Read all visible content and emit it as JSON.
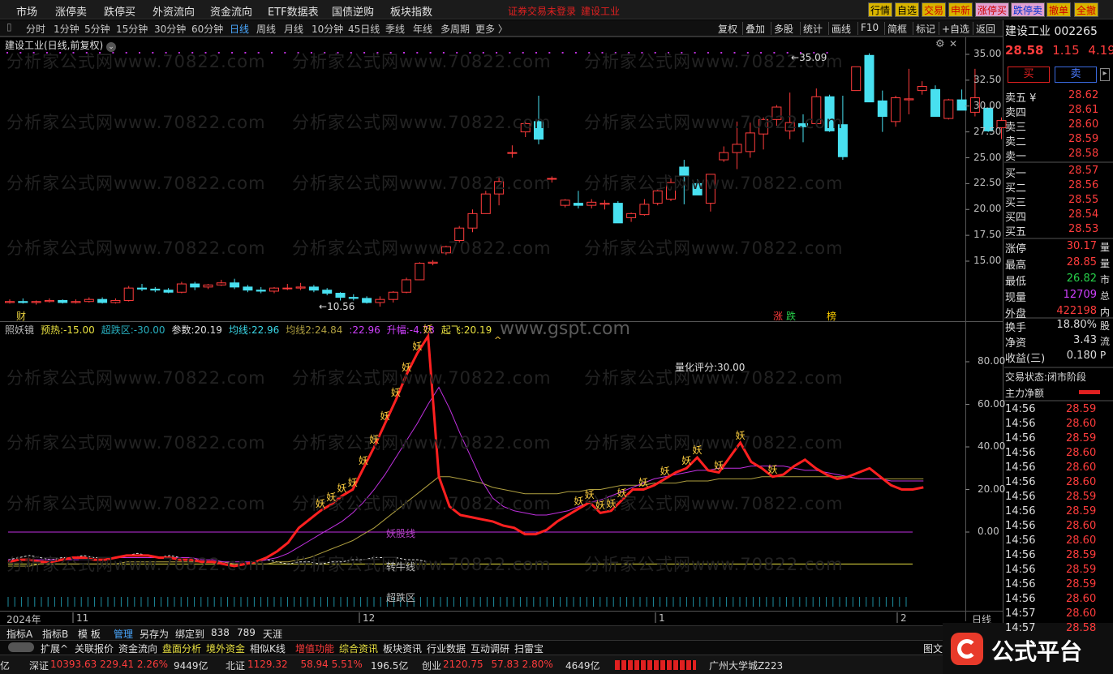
{
  "menu": {
    "items": [
      "市场",
      "涨停卖",
      "跌停买",
      "外资流向",
      "资金流向",
      "ETF数据表",
      "国债逆购",
      "板块指数"
    ],
    "warning": "证券交易未登录",
    "stock_link": "建设工业",
    "right_buttons": [
      {
        "label": "行情",
        "bg": "#d8b400",
        "fg": "#000"
      },
      {
        "label": "自选",
        "bg": "#d8b400",
        "fg": "#000"
      },
      {
        "label": "交易",
        "bg": "#d8b400",
        "fg": "#d00000"
      },
      {
        "label": "申新",
        "bg": "#d8b400",
        "fg": "#d00000"
      },
      {
        "label": "涨停买",
        "bg": "#e0a0d0",
        "fg": "#d00000"
      },
      {
        "label": "跌停卖",
        "bg": "#e0a0d0",
        "fg": "#0030d0"
      },
      {
        "label": "撤单",
        "bg": "#d8b400",
        "fg": "#d00000"
      },
      {
        "label": "全撤",
        "bg": "#d8b400",
        "fg": "#d00000"
      }
    ]
  },
  "periods": [
    "分时",
    "1分钟",
    "5分钟",
    "15分钟",
    "30分钟",
    "60分钟",
    "日线",
    "周线",
    "月线",
    "10分钟",
    "45日线",
    "季线",
    "年线",
    "多周期",
    "更多 〉"
  ],
  "selected_period": "日线",
  "tools": [
    "复权",
    "叠加",
    "多股",
    "统计",
    "画线",
    "F10",
    "简框",
    "标记",
    "+自选",
    "返回"
  ],
  "chart": {
    "title": "建设工业(日线,前复权)",
    "title_icon": "chevron-down-icon",
    "high_label": "35.09",
    "low_label": "10.56",
    "fin_mark": "财",
    "signals": [
      {
        "t": "涨",
        "c": "#ff3c3c"
      },
      {
        "t": "跌",
        "c": "#27d04a"
      },
      {
        "t": "榜",
        "c": "#ffd000"
      }
    ],
    "yticks": [
      "35.00",
      "32.50",
      "30.00",
      "27.50",
      "25.00",
      "22.50",
      "20.00",
      "17.50",
      "15.00"
    ]
  },
  "chart_data": [
    {
      "type": "candlestick",
      "title": "建设工业(日线,前复权)",
      "ylim": [
        10,
        36
      ],
      "ohlc": [
        [
          11.0,
          11.3,
          10.9,
          11.1
        ],
        [
          11.1,
          11.4,
          10.9,
          11.0
        ],
        [
          11.0,
          11.2,
          10.8,
          11.1
        ],
        [
          11.1,
          11.4,
          11.0,
          11.2
        ],
        [
          11.2,
          11.3,
          10.9,
          11.0
        ],
        [
          11.0,
          11.3,
          10.9,
          11.1
        ],
        [
          11.1,
          11.5,
          11.0,
          11.3
        ],
        [
          11.3,
          11.5,
          10.9,
          11.0
        ],
        [
          11.0,
          11.4,
          10.9,
          11.2
        ],
        [
          11.2,
          12.6,
          11.1,
          12.4
        ],
        [
          12.4,
          12.8,
          12.1,
          12.3
        ],
        [
          12.3,
          12.5,
          12.0,
          12.2
        ],
        [
          12.2,
          12.4,
          11.9,
          12.0
        ],
        [
          12.0,
          13.0,
          11.9,
          12.8
        ],
        [
          12.8,
          13.0,
          12.2,
          12.5
        ],
        [
          12.5,
          12.8,
          12.3,
          12.7
        ],
        [
          12.7,
          13.2,
          12.6,
          12.9
        ],
        [
          12.9,
          13.3,
          12.3,
          12.5
        ],
        [
          12.5,
          12.7,
          12.0,
          12.2
        ],
        [
          12.2,
          12.5,
          11.9,
          12.1
        ],
        [
          12.1,
          12.5,
          11.9,
          12.4
        ],
        [
          12.4,
          12.8,
          12.2,
          12.4
        ],
        [
          12.4,
          12.9,
          12.2,
          12.5
        ],
        [
          12.5,
          12.7,
          12.0,
          12.2
        ],
        [
          12.2,
          12.4,
          11.7,
          11.9
        ],
        [
          11.9,
          12.0,
          11.2,
          11.5
        ],
        [
          11.5,
          11.8,
          11.2,
          11.4
        ],
        [
          11.4,
          11.6,
          10.9,
          11.0
        ],
        [
          11.0,
          11.6,
          10.6,
          11.3
        ],
        [
          11.3,
          12.1,
          11.0,
          12.0
        ],
        [
          12.0,
          13.4,
          11.9,
          13.2
        ],
        [
          13.2,
          14.9,
          13.2,
          14.8
        ],
        [
          14.8,
          15.1,
          14.6,
          14.9
        ],
        [
          15.8,
          16.5,
          15.6,
          16.4
        ],
        [
          17.0,
          18.4,
          16.8,
          18.2
        ],
        [
          18.2,
          20.0,
          17.8,
          19.6
        ],
        [
          19.6,
          21.8,
          19.6,
          21.5
        ],
        [
          21.5,
          23.2,
          20.4,
          22.7
        ],
        [
          25.5,
          26.2,
          25.0,
          25.5
        ],
        [
          27.5,
          28.5,
          27.0,
          28.3
        ],
        [
          28.5,
          31.0,
          26.3,
          26.8
        ],
        [
          23.0,
          23.2,
          22.6,
          23.0
        ],
        [
          20.4,
          21.0,
          20.2,
          20.9
        ],
        [
          20.6,
          21.8,
          20.1,
          20.4
        ],
        [
          20.4,
          21.0,
          20.1,
          20.7
        ],
        [
          20.5,
          20.9,
          20.0,
          20.6
        ],
        [
          20.6,
          20.8,
          18.7,
          18.7
        ],
        [
          19.2,
          19.7,
          18.8,
          19.6
        ],
        [
          19.5,
          21.0,
          19.4,
          20.5
        ],
        [
          20.6,
          22.0,
          20.4,
          21.8
        ],
        [
          21.0,
          23.0,
          20.8,
          22.6
        ],
        [
          24.1,
          24.8,
          20.5,
          23.2
        ],
        [
          22.5,
          22.9,
          21.4,
          21.4
        ],
        [
          20.6,
          21.7,
          19.8,
          23.4
        ],
        [
          24.8,
          26.1,
          24.6,
          25.5
        ],
        [
          25.5,
          28.5,
          23.9,
          26.3
        ],
        [
          25.6,
          28.4,
          25.0,
          27.4
        ],
        [
          27.3,
          28.9,
          25.8,
          28.7
        ],
        [
          28.7,
          30.1,
          28.1,
          29.9
        ],
        [
          27.6,
          31.3,
          26.8,
          28.4
        ],
        [
          28.3,
          29.2,
          26.5,
          28.0
        ],
        [
          28.3,
          31.7,
          28.3,
          30.9
        ],
        [
          30.9,
          31.1,
          27.5,
          27.6
        ],
        [
          28.2,
          31.0,
          24.8,
          25.1
        ],
        [
          31.5,
          33.8,
          31.5,
          33.8
        ],
        [
          34.9,
          35.1,
          30.4,
          30.4
        ],
        [
          30.5,
          31.5,
          27.5,
          29.0
        ],
        [
          28.5,
          31.0,
          28.0,
          30.8
        ],
        [
          30.6,
          33.6,
          29.2,
          30.7
        ],
        [
          31.5,
          32.4,
          31.1,
          31.9
        ],
        [
          31.6,
          32.0,
          29.0,
          29.0
        ],
        [
          28.8,
          30.7,
          28.7,
          30.6
        ],
        [
          30.6,
          31.6,
          29.6,
          29.6
        ],
        [
          29.4,
          33.6,
          29.0,
          30.8
        ],
        [
          29.8,
          29.8,
          27.5,
          27.6
        ],
        [
          27.9,
          28.9,
          26.8,
          28.6
        ]
      ]
    },
    {
      "type": "line",
      "title": "照妖镜",
      "ylim": [
        -40,
        95
      ],
      "yticks": [
        "80.00",
        "60.00",
        "40.00",
        "20.00",
        "0.00"
      ],
      "legend": [
        {
          "name": "照妖镜",
          "c": "#bbbbbb"
        },
        {
          "name": "预热:",
          "v": "-15.00",
          "c": "#e8e040"
        },
        {
          "name": "超跌区:",
          "v": "-30.00",
          "c": "#28b0c0"
        },
        {
          "name": "参数:",
          "v": "20.19",
          "c": "#e0e0e0"
        },
        {
          "name": "均线:",
          "v": "22.96",
          "c": "#3ad8e8"
        },
        {
          "name": "均线2:",
          "v": "24.84",
          "c": "#b0a040"
        },
        {
          "name": "",
          "v": ":22.96",
          "c": "#d040ff"
        },
        {
          "name": "升幅:",
          "v": "-4.73",
          "c": "#d040ff"
        },
        {
          "name": "起飞:",
          "v": "20.19",
          "c": "#e8e040"
        }
      ],
      "annotation": "量化评分:30.00",
      "yao_char": "妖",
      "labels": [
        "妖股线",
        "转牛线",
        "超跌区"
      ],
      "lines": {
        "yaogu": 0,
        "zhuanniu": -15
      },
      "series": [
        {
          "name": "参数",
          "color": "#ff2020",
          "values": [
            -14,
            -13,
            -13,
            -14,
            -14,
            -13,
            -12,
            -12,
            -13,
            -13,
            -12,
            -11,
            -11,
            -11,
            -12,
            -12,
            -13,
            -13,
            -14,
            -14,
            -15,
            -16,
            -15,
            -14,
            -12,
            -9,
            -5,
            2,
            6,
            10,
            13,
            17,
            20,
            30,
            40,
            51,
            62,
            74,
            84,
            92,
            26,
            12,
            8,
            7,
            6,
            5,
            3,
            2,
            -1,
            -1,
            1,
            5,
            8,
            11,
            14,
            9,
            10,
            15,
            20,
            20,
            22,
            25,
            28,
            30,
            35,
            29,
            28,
            35,
            42,
            33,
            30,
            26,
            27,
            31,
            34,
            30,
            27,
            25,
            26,
            28,
            30,
            26,
            22,
            20,
            20,
            21
          ]
        },
        {
          "name": "均线",
          "color": "#c030e0",
          "values": [
            -13,
            -13,
            -13,
            -13,
            -13,
            -13,
            -13,
            -13,
            -13,
            -13,
            -12,
            -12,
            -12,
            -12,
            -12,
            -12,
            -12,
            -12,
            -13,
            -13,
            -14,
            -14,
            -14,
            -14,
            -13,
            -12,
            -10,
            -7,
            -4,
            -1,
            2,
            5,
            9,
            14,
            20,
            27,
            35,
            43,
            51,
            60,
            68,
            58,
            46,
            35,
            24,
            16,
            12,
            10,
            9,
            8,
            8,
            9,
            10,
            12,
            14,
            15,
            17,
            19,
            21,
            23,
            25,
            26,
            27,
            28,
            29,
            29,
            30,
            30,
            30,
            31,
            31,
            31,
            31,
            30,
            29,
            29,
            28,
            27,
            26,
            25,
            25,
            25,
            24,
            24,
            24,
            24
          ]
        },
        {
          "name": "均线2",
          "color": "#b0a040",
          "values": [
            -16,
            -16,
            -16,
            -15,
            -15,
            -15,
            -15,
            -15,
            -15,
            -15,
            -15,
            -14,
            -14,
            -14,
            -14,
            -14,
            -14,
            -14,
            -14,
            -14,
            -14,
            -15,
            -15,
            -15,
            -15,
            -14,
            -14,
            -13,
            -12,
            -10,
            -8,
            -6,
            -4,
            -1,
            2,
            6,
            10,
            14,
            18,
            22,
            26,
            26,
            25,
            24,
            23,
            21,
            20,
            19,
            18,
            18,
            18,
            18,
            19,
            19,
            20,
            20,
            21,
            22,
            22,
            22,
            23,
            23,
            23,
            24,
            24,
            24,
            25,
            25,
            25,
            25,
            26,
            26,
            26,
            26,
            26,
            26,
            26,
            26,
            26,
            25,
            25,
            25,
            25,
            25,
            25,
            25
          ]
        },
        {
          "name": "白线",
          "color": "#e0e0e0",
          "values": [
            -13,
            -12,
            -11,
            -12,
            -13,
            -12,
            -12,
            -11,
            -12,
            -12,
            -12,
            -11,
            -10,
            -11,
            -12,
            -11,
            -12,
            -12,
            -14,
            -14,
            -14,
            -15,
            -15,
            -14,
            -13,
            -14,
            -15,
            -14,
            -14,
            -15,
            -14,
            -14,
            -13,
            -13,
            -12,
            -12,
            -12,
            -13,
            -13,
            -14
          ]
        }
      ],
      "yao_markers": [
        29,
        30,
        31,
        32,
        33,
        34,
        35,
        36,
        37,
        38,
        39,
        53,
        54,
        55,
        56,
        57,
        59,
        61,
        63,
        64,
        66,
        68,
        71
      ]
    }
  ],
  "xaxis": {
    "labels": [
      "2024年",
      "11",
      "12",
      "1",
      "2"
    ],
    "right_label": "日线"
  },
  "tabs": [
    {
      "t": "指标A",
      "c": "#e0e0e0"
    },
    {
      "t": "指标B",
      "c": "#e0e0e0"
    },
    {
      "t": "模 板",
      "c": "#e0e0e0"
    },
    {
      "t": "管理",
      "c": "#4aa8ff"
    },
    {
      "t": "另存为",
      "c": "#e0e0e0"
    },
    {
      "t": "绑定到",
      "c": "#e0e0e0"
    },
    {
      "t": "838",
      "c": "#e0e0e0"
    },
    {
      "t": "789",
      "c": "#e0e0e0"
    },
    {
      "t": "天涯",
      "c": "#e0e0e0"
    }
  ],
  "tabs2": [
    {
      "t": "扩展^",
      "c": "#e0e0e0"
    },
    {
      "t": "关联报价",
      "c": "#e0e0e0"
    },
    {
      "t": "资金流向",
      "c": "#e0e0e0"
    },
    {
      "t": "盘面分析",
      "c": "#e8e040"
    },
    {
      "t": "境外资金",
      "c": "#e8e040"
    },
    {
      "t": "相似K线",
      "c": "#e0e0e0"
    },
    {
      "t": "增值功能",
      "c": "#ff3c3c"
    },
    {
      "t": "综合资讯",
      "c": "#e8e040"
    },
    {
      "t": "板块资讯",
      "c": "#e0e0e0"
    },
    {
      "t": "行业数据",
      "c": "#e0e0e0"
    },
    {
      "t": "互动调研",
      "c": "#e0e0e0"
    },
    {
      "t": "扫雷宝",
      "c": "#e0e0e0"
    }
  ],
  "right_tab": "图文",
  "status": {
    "lead": "亿",
    "sz_label": "深证",
    "sz": "10393.63",
    "sz_chg": "229.41",
    "sz_pct": "2.26%",
    "sz_amt": "9449亿",
    "bz_label": "北证",
    "bz": "1129.32",
    "bz_chg": "58.94",
    "bz_pct": "5.51%",
    "bz_amt": "196.5亿",
    "cy_label": "创业",
    "cy": "2120.75",
    "cy_chg": "57.83",
    "cy_pct": "2.80%",
    "cy_amt": "4649亿",
    "news": "广州大学城Z223"
  },
  "logo": "公式平台",
  "watermarks": {
    "main": "分析家公式网www.70822.com",
    "site": "www.gspt.com"
  },
  "quote": {
    "name": "建设工业",
    "code": "002265",
    "price": "28.58",
    "chg": "1.15",
    "pct": "4.19%",
    "buy": "买",
    "sell": "卖",
    "asks": [
      {
        "l": "卖五 ¥",
        "p": "28.62"
      },
      {
        "l": "卖四",
        "p": "28.61"
      },
      {
        "l": "卖三",
        "p": "28.60"
      },
      {
        "l": "卖二",
        "p": "28.59"
      },
      {
        "l": "卖一",
        "p": "28.58"
      }
    ],
    "bids": [
      {
        "l": "买一",
        "p": "28.57"
      },
      {
        "l": "买二",
        "p": "28.56"
      },
      {
        "l": "买三",
        "p": "28.55"
      },
      {
        "l": "买四",
        "p": "28.54"
      },
      {
        "l": "买五",
        "p": "28.53"
      }
    ],
    "stats": [
      {
        "l": "涨停",
        "v": "30.17",
        "c": "red",
        "x": "量"
      },
      {
        "l": "最高",
        "v": "28.85",
        "c": "red",
        "x": "量"
      },
      {
        "l": "最低",
        "v": "26.82",
        "c": "grn",
        "x": "市"
      },
      {
        "l": "现量",
        "v": "12709",
        "c": "mag",
        "x": "总"
      },
      {
        "l": "外盘",
        "v": "422198",
        "c": "red",
        "x": "内"
      }
    ],
    "stats2": [
      {
        "l": "换手",
        "v": "18.80%",
        "x": "股"
      },
      {
        "l": "净资",
        "v": "3.43",
        "x": "流"
      },
      {
        "l": "收益(三)",
        "v": "0.180",
        "x": "P"
      }
    ],
    "trade_state_label": "交易状态:",
    "trade_state": "闭市阶段",
    "main_net": "主力净额",
    "ticks": [
      {
        "t": "14:56",
        "p": "28.59"
      },
      {
        "t": "14:56",
        "p": "28.60"
      },
      {
        "t": "14:56",
        "p": "28.59"
      },
      {
        "t": "14:56",
        "p": "28.60"
      },
      {
        "t": "14:56",
        "p": "28.60"
      },
      {
        "t": "14:56",
        "p": "28.60"
      },
      {
        "t": "14:56",
        "p": "28.59"
      },
      {
        "t": "14:56",
        "p": "28.59"
      },
      {
        "t": "14:56",
        "p": "28.60"
      },
      {
        "t": "14:56",
        "p": "28.60"
      },
      {
        "t": "14:56",
        "p": "28.59"
      },
      {
        "t": "14:56",
        "p": "28.59"
      },
      {
        "t": "14:56",
        "p": "28.59"
      },
      {
        "t": "14:56",
        "p": "28.60"
      },
      {
        "t": "14:57",
        "p": "28.60"
      },
      {
        "t": "14:57",
        "p": "28.58"
      }
    ]
  }
}
